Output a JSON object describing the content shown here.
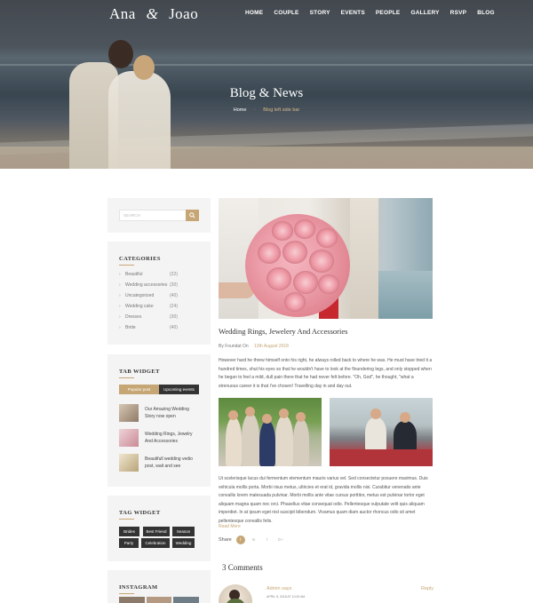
{
  "site": {
    "logo_left": "Ana",
    "logo_amp": "&",
    "logo_right": "Joao",
    "nav": [
      "HOME",
      "COUPLE",
      "STORY",
      "EVENTS",
      "PEOPLE",
      "GALLERY",
      "RSVP",
      "BLOG"
    ]
  },
  "hero": {
    "title": "Blog & News",
    "breadcrumb_home": "Home",
    "breadcrumb_current": "Blog left side bar"
  },
  "sidebar": {
    "search": {
      "placeholder": "SEARCH"
    },
    "categories": {
      "title": "CATEGORIES",
      "items": [
        {
          "name": "Beautiful",
          "count": "(22)"
        },
        {
          "name": "Wedding accessories",
          "count": "(30)"
        },
        {
          "name": "Uncategorized",
          "count": "(40)"
        },
        {
          "name": "Wedding cake",
          "count": "(24)"
        },
        {
          "name": "Dresses",
          "count": "(30)"
        },
        {
          "name": "Bride",
          "count": "(40)"
        }
      ]
    },
    "tab_widget": {
      "title": "TAB WIDGET",
      "tab_popular": "Popular post",
      "tab_upcoming": "Upcoming events",
      "posts": [
        "Our Amazing Wedding Story now open",
        "Wedding Rings, Jewelry And Accessories",
        "Beautifull wedding vedio post, wait and see"
      ]
    },
    "tag_widget": {
      "title": "TAG WIDGET",
      "tags": [
        "Brides",
        "Best Friend",
        "Season",
        "Party",
        "Celebration",
        "Wedding"
      ]
    },
    "instagram": {
      "title": "INSTAGRAM"
    }
  },
  "post": {
    "title": "Wedding Rings, Jewelery And Accessories",
    "by_label": "By",
    "author": "Foundat On",
    "date": "13th August 2018",
    "paragraph1": "However hard he threw himself onto his right, he always rolled back to where he was. He must have tried it a hundred times, shut his eyes so that he wouldn't have to look at the floundering legs, and only stopped when he began to feel a mild, dull pain there that he had never felt before. \"Oh, God\", he thought, \"what a strenuous career it is that I've chosen! Travelling day in and day out.",
    "paragraph2": "Ut scelerisque lacus dui fermentum elementum mauris varius vel. Sed consectetur posuere maximus. Duis vehicula mollis porta. Morbi risus metus, ultricies et erat id, gravida mollis nisi. Curabitur venenatis ante convallis lorem malesuada pulvinar. Morbi mollis ante vitae cursus porttitor, metus est pulvinar tortor eget aliquam magna quam nec orci. Phasellus vitae consequat odio. Pellentesque vulputate velit quis aliquam imperdiet. In at ipsum eget nisl suscipit bibendum. Vivamus quam diam auctor rhoncus odio sit amet pellentesque convallis felis.",
    "read_more": "Read More",
    "share_label": "Share",
    "share_buttons": [
      "f",
      "in",
      "t",
      "G+"
    ]
  },
  "comments": {
    "title": "3 Comments",
    "first": {
      "author": "Admin says",
      "date": "APRIL 8, 2018 AT 10:45 AM",
      "reply": "Reply"
    }
  },
  "colors": {
    "accent": "#c6a674",
    "dark": "#333333",
    "widget_bg": "#f4f4f4"
  }
}
